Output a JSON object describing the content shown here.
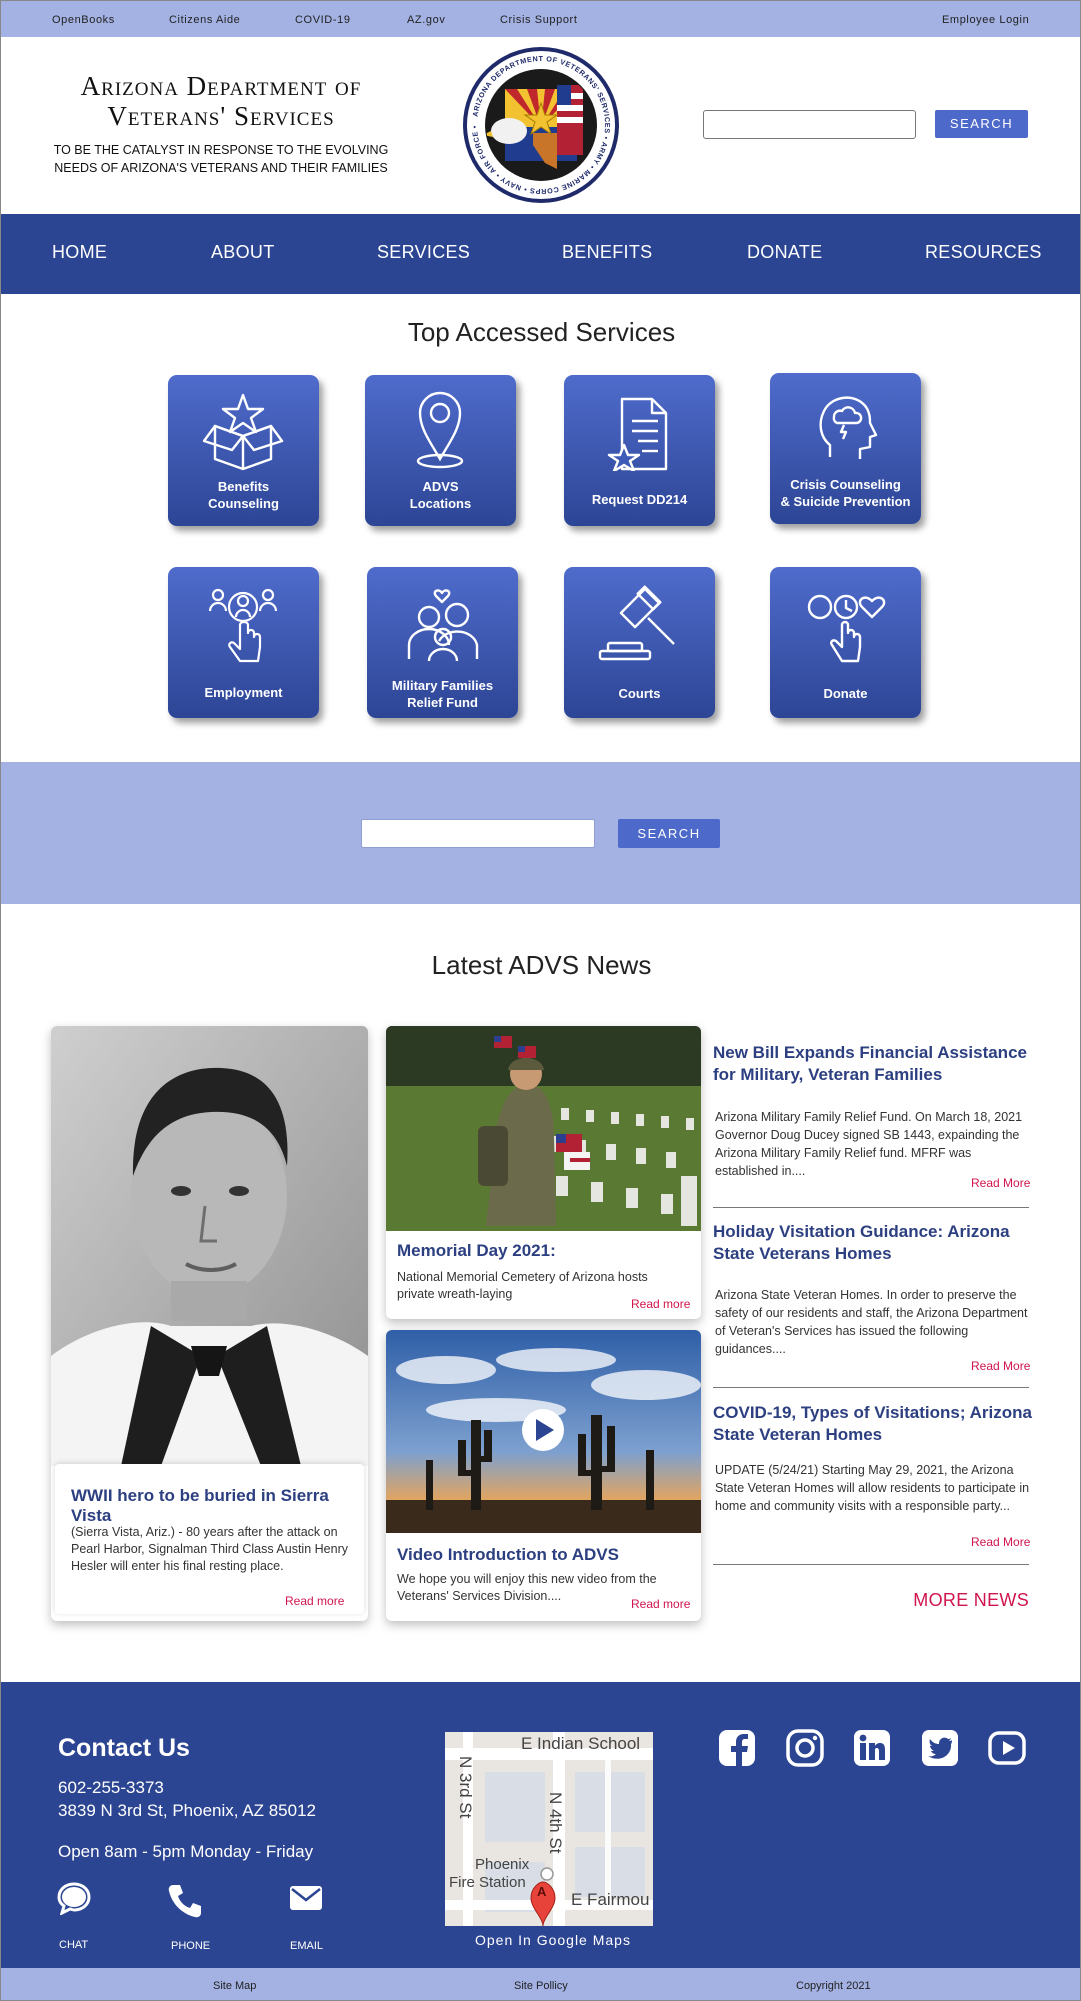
{
  "topbar": {
    "links": [
      "OpenBooks",
      "Citizens Aide",
      "COVID-19",
      "AZ.gov",
      "Crisis Support"
    ],
    "login": "Employee Login"
  },
  "header": {
    "title_line1": "Arizona Department of",
    "title_line2": "Veterans' Services",
    "tagline_line1": "TO BE THE CATALYST IN RESPONSE TO THE EVOLVING",
    "tagline_line2": "NEEDS OF ARIZONA'S VETERANS AND THEIR FAMILIES",
    "seal_text": "ARIZONA DEPARTMENT OF VETERANS' SERVICES • ARMY • MARINE CORPS • NAVY • AIR FORCE • COAST GUARD",
    "search_value": "",
    "search_label": "SEARCH"
  },
  "nav": [
    "HOME",
    "ABOUT",
    "SERVICES",
    "BENEFITS",
    "DONATE",
    "RESOURCES"
  ],
  "services": {
    "title": "Top Accessed Services",
    "tiles": [
      {
        "line1": "Benefits",
        "line2": "Counseling",
        "icon": "box-star-icon"
      },
      {
        "line1": "ADVS",
        "line2": "Locations",
        "icon": "map-pin-icon"
      },
      {
        "line1": "Request DD214",
        "line2": "",
        "icon": "document-star-icon"
      },
      {
        "line1": "Crisis Counseling",
        "line2": "& Suicide Prevention",
        "icon": "head-cloud-icon"
      },
      {
        "line1": "Employment",
        "line2": "",
        "icon": "hand-people-icon"
      },
      {
        "line1": "Military Families",
        "line2": "Relief Fund",
        "icon": "family-icon"
      },
      {
        "line1": "Courts",
        "line2": "",
        "icon": "gavel-icon"
      },
      {
        "line1": "Donate",
        "line2": "",
        "icon": "hand-heart-icon"
      }
    ]
  },
  "mid_search": {
    "value": "",
    "label": "SEARCH"
  },
  "news": {
    "title": "Latest  ADVS News",
    "feature": {
      "title": "WWII hero to be buried in Sierra Vista",
      "body": "(Sierra Vista, Ariz.) - 80 years after the attack on Pearl Harbor, Signalman Third Class Austin Henry Hesler will enter his final resting place.",
      "read_more": "Read more"
    },
    "memorial": {
      "title": "Memorial Day 2021:",
      "body": "National Memorial Cemetery of Arizona hosts private wreath-laying",
      "read_more": "Read more"
    },
    "video": {
      "title": "Video Introduction to ADVS",
      "body": "We hope you will enjoy this new video from the Veterans' Services Division....",
      "read_more": "Read more"
    },
    "list": [
      {
        "title": "New Bill Expands Financial Assistance for Military, Veteran Families",
        "body": "Arizona Military Family Relief Fund. On March 18, 2021 Governor Doug Ducey signed SB 1443, expainding the Arizona Military Family Relief fund. MFRF was established in....",
        "read_more": "Read More"
      },
      {
        "title": "Holiday Visitation Guidance: Arizona State Veterans Homes",
        "body": "Arizona State Veteran Homes. In order to preserve the safety of our residents and staff, the Arizona Department of Veteran's Services has issued the following guidances....",
        "read_more": "Read More"
      },
      {
        "title": "COVID-19, Types of Visitations; Arizona State Veteran Homes",
        "body": "UPDATE (5/24/21) Starting May 29, 2021, the Arizona State Veteran Homes will allow residents to participate in home and community visits with a responsible party...",
        "read_more": "Read More"
      }
    ],
    "more": "MORE NEWS"
  },
  "contact": {
    "title": "Contact Us",
    "phone": "602-255-3373",
    "address": "3839 N 3rd St, Phoenix, AZ 85012",
    "hours": "Open 8am - 5pm Monday - Friday",
    "chat": "CHAT",
    "phone_label": "PHONE",
    "email": "EMAIL"
  },
  "map": {
    "street_top": "E Indian School",
    "street_left": "N 3rd St",
    "street_right": "N 4th St",
    "place_line1": "Phoenix",
    "place_line2": "Fire Station",
    "street_bottom": "E Fairmou",
    "marker": "A",
    "open_label": "Open In Google Maps"
  },
  "social": [
    "facebook-icon",
    "instagram-icon",
    "linkedin-icon",
    "twitter-icon",
    "youtube-icon"
  ],
  "bottom": {
    "sitemap": "Site Map",
    "policy": "Site Pollicy",
    "copyright": "Copyright 2021"
  },
  "colors": {
    "nav": "#2c4592",
    "light": "#a3b2e3",
    "button": "#4d69c9",
    "accent": "#d0154d",
    "headline": "#2c3f80"
  }
}
